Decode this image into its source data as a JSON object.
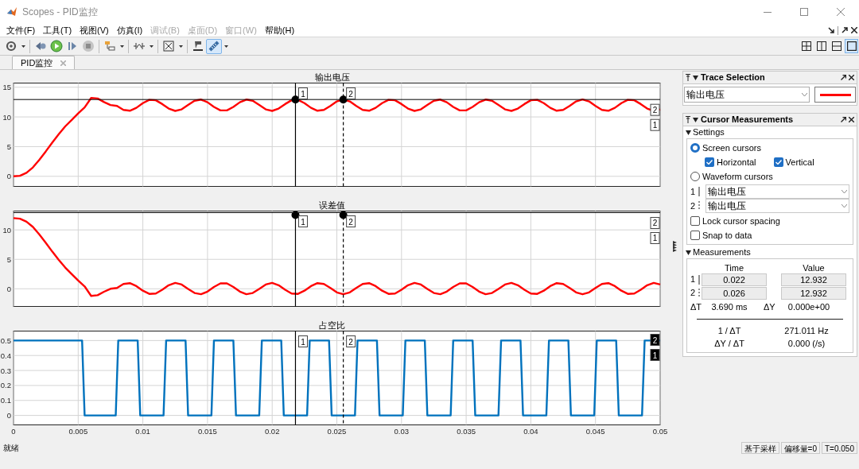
{
  "window": {
    "title": "Scopes - PID监控"
  },
  "menu": [
    {
      "label": "文件(F)",
      "disabled": false
    },
    {
      "label": "工具(T)",
      "disabled": false
    },
    {
      "label": "视图(V)",
      "disabled": false
    },
    {
      "label": "仿真(I)",
      "disabled": false
    },
    {
      "label": "调试(B)",
      "disabled": true
    },
    {
      "label": "桌面(D)",
      "disabled": true
    },
    {
      "label": "窗口(W)",
      "disabled": true
    },
    {
      "label": "帮助(H)",
      "disabled": false
    }
  ],
  "toolbar": [
    {
      "kind": "settings",
      "selected": false
    },
    {
      "kind": "step_back",
      "selected": false
    },
    {
      "kind": "run",
      "selected": false
    },
    {
      "kind": "step_forward",
      "selected": false
    },
    {
      "kind": "stop",
      "selected": false
    },
    {
      "kind": "highlight",
      "selected": false
    },
    {
      "kind": "trigger",
      "selected": false
    },
    {
      "kind": "zoom",
      "selected": false
    },
    {
      "kind": "style",
      "selected": false
    },
    {
      "kind": "cursor",
      "selected": true
    }
  ],
  "layouts": [
    {
      "kind": "grid4",
      "selected": false
    },
    {
      "kind": "cols2",
      "selected": false
    },
    {
      "kind": "rows2",
      "selected": false
    },
    {
      "kind": "single",
      "selected": true
    }
  ],
  "tabs": [
    {
      "label": "PID监控",
      "selected": true
    }
  ],
  "plots": [
    {
      "cursor_labels": {
        "vertical": [
          "1",
          "2"
        ],
        "horizontal": [
          "2",
          "1"
        ]
      },
      "chart_data": {
        "type": "line",
        "title": "输出电压",
        "grid": true,
        "xlim": [
          0,
          0.05
        ],
        "ylim": [
          -1.7,
          15.7
        ],
        "yticks": [
          0,
          5,
          10,
          15
        ],
        "x": [
          0,
          0.0005,
          0.001,
          0.0015,
          0.002,
          0.0025,
          0.003,
          0.0035,
          0.004,
          0.0045,
          0.005,
          0.0055,
          0.006,
          0.0065,
          0.007,
          0.0075,
          0.008,
          0.0085,
          0.009,
          0.0095,
          0.01,
          0.0105,
          0.011,
          0.0115,
          0.012,
          0.0125,
          0.013,
          0.0135,
          0.014,
          0.0145,
          0.015,
          0.0155,
          0.016,
          0.0165,
          0.017,
          0.0175,
          0.018,
          0.0185,
          0.019,
          0.0195,
          0.02,
          0.0205,
          0.021,
          0.0215,
          0.022,
          0.0225,
          0.023,
          0.0235,
          0.024,
          0.0245,
          0.025,
          0.0255,
          0.026,
          0.0265,
          0.027,
          0.0275,
          0.028,
          0.0285,
          0.029,
          0.0295,
          0.03,
          0.0305,
          0.031,
          0.0315,
          0.032,
          0.0325,
          0.033,
          0.0335,
          0.034,
          0.0345,
          0.035,
          0.0355,
          0.036,
          0.0365,
          0.037,
          0.0375,
          0.038,
          0.0385,
          0.039,
          0.0395,
          0.04,
          0.0405,
          0.041,
          0.0415,
          0.042,
          0.0425,
          0.043,
          0.0435,
          0.044,
          0.0445,
          0.045,
          0.0455,
          0.046,
          0.0465,
          0.047,
          0.0475,
          0.048,
          0.0485,
          0.049,
          0.0495,
          0.05
        ],
        "series": [
          {
            "color": "#ff0000",
            "values": [
              0,
              0.1,
              0.6,
              1.5,
              2.8,
              4.2,
              5.7,
              7.1,
              8.4,
              9.5,
              10.6,
              11.6,
              13.2,
              13.1,
              12.5,
              12.0,
              11.85,
              11.18,
              11.04,
              11.54,
              12.33,
              12.87,
              12.81,
              12.17,
              11.4,
              11.01,
              11.27,
              12.01,
              12.72,
              12.92,
              12.47,
              11.69,
              11.09,
              11.09,
              11.69,
              12.47,
              12.92,
              12.72,
              12.01,
              11.27,
              11.01,
              11.4,
              12.17,
              12.81,
              12.87,
              12.33,
              11.54,
              11.04,
              11.18,
              11.85,
              12.61,
              12.93,
              12.61,
              11.85,
              11.18,
              11.04,
              11.54,
              12.33,
              12.87,
              12.81,
              12.17,
              11.4,
              11.01,
              11.27,
              12.01,
              12.72,
              12.92,
              12.47,
              11.69,
              11.09,
              11.09,
              11.69,
              12.47,
              12.92,
              12.72,
              12.01,
              11.27,
              11.01,
              11.4,
              12.17,
              12.81,
              12.87,
              12.33,
              11.54,
              11.04,
              11.18,
              11.85,
              12.61,
              12.93,
              12.61,
              11.85,
              11.18,
              11.04,
              11.54,
              12.33,
              12.87,
              12.81,
              12.17,
              11.4,
              11.01,
              11.27
            ]
          }
        ],
        "ref_lines": [
          {
            "axis": "x",
            "value": 0.0218
          },
          {
            "axis": "x",
            "value": 0.0255
          },
          {
            "axis": "y",
            "value": 12.932
          }
        ]
      }
    },
    {
      "cursor_labels": {
        "vertical": [
          "1",
          "2"
        ],
        "horizontal": [
          "2",
          "1"
        ]
      },
      "chart_data": {
        "type": "line",
        "title": "误差值",
        "grid": true,
        "xlim": [
          0,
          0.05
        ],
        "ylim": [
          -3,
          13.2
        ],
        "yticks": [
          0,
          5,
          10
        ],
        "x": [
          0,
          0.0005,
          0.001,
          0.0015,
          0.002,
          0.0025,
          0.003,
          0.0035,
          0.004,
          0.0045,
          0.005,
          0.0055,
          0.006,
          0.0065,
          0.007,
          0.0075,
          0.008,
          0.0085,
          0.009,
          0.0095,
          0.01,
          0.0105,
          0.011,
          0.0115,
          0.012,
          0.0125,
          0.013,
          0.0135,
          0.014,
          0.0145,
          0.015,
          0.0155,
          0.016,
          0.0165,
          0.017,
          0.0175,
          0.018,
          0.0185,
          0.019,
          0.0195,
          0.02,
          0.0205,
          0.021,
          0.0215,
          0.022,
          0.0225,
          0.023,
          0.0235,
          0.024,
          0.0245,
          0.025,
          0.0255,
          0.026,
          0.0265,
          0.027,
          0.0275,
          0.028,
          0.0285,
          0.029,
          0.0295,
          0.03,
          0.0305,
          0.031,
          0.0315,
          0.032,
          0.0325,
          0.033,
          0.0335,
          0.034,
          0.0345,
          0.035,
          0.0355,
          0.036,
          0.0365,
          0.037,
          0.0375,
          0.038,
          0.0385,
          0.039,
          0.0395,
          0.04,
          0.0405,
          0.041,
          0.0415,
          0.042,
          0.0425,
          0.043,
          0.0435,
          0.044,
          0.0445,
          0.045,
          0.0455,
          0.046,
          0.0465,
          0.047,
          0.0475,
          0.048,
          0.0485,
          0.049,
          0.0495,
          0.05
        ],
        "series": [
          {
            "color": "#ff0000",
            "values": [
              12,
              11.9,
              11.4,
              10.5,
              9.2,
              7.8,
              6.3,
              4.9,
              3.6,
              2.5,
              1.4,
              0.4,
              -1.2,
              -1.1,
              -0.5,
              0.0,
              0.15,
              0.82,
              0.96,
              0.46,
              -0.33,
              -0.87,
              -0.81,
              -0.17,
              0.6,
              0.99,
              0.73,
              -0.01,
              -0.72,
              -0.92,
              -0.47,
              0.31,
              0.91,
              0.91,
              0.31,
              -0.47,
              -0.92,
              -0.72,
              -0.01,
              0.73,
              0.99,
              0.6,
              -0.17,
              -0.81,
              -0.87,
              -0.33,
              0.46,
              0.96,
              0.82,
              0.15,
              -0.61,
              -0.93,
              -0.61,
              0.15,
              0.82,
              0.96,
              0.46,
              -0.33,
              -0.87,
              -0.81,
              -0.17,
              0.6,
              0.99,
              0.73,
              -0.01,
              -0.72,
              -0.92,
              -0.47,
              0.31,
              0.91,
              0.91,
              0.31,
              -0.47,
              -0.92,
              -0.72,
              -0.01,
              0.73,
              0.99,
              0.6,
              -0.17,
              -0.81,
              -0.87,
              -0.33,
              0.46,
              0.96,
              0.82,
              0.15,
              -0.61,
              -0.93,
              -0.61,
              0.15,
              0.82,
              0.96,
              0.46,
              -0.33,
              -0.87,
              -0.81,
              -0.17,
              0.6,
              0.99,
              0.73
            ]
          }
        ],
        "ref_lines": [
          {
            "axis": "x",
            "value": 0.0218
          },
          {
            "axis": "x",
            "value": 0.0255
          },
          {
            "axis": "y",
            "value": 12.932
          }
        ]
      }
    },
    {
      "cursor_labels": {
        "vertical": [
          "1",
          "2"
        ],
        "horizontal": [
          "2",
          "1"
        ]
      },
      "chart_data": {
        "type": "line",
        "title": "占空比",
        "grid": true,
        "xlim": [
          0,
          0.05
        ],
        "ylim": [
          -0.063,
          0.563
        ],
        "xticks": [
          0,
          0.005,
          0.01,
          0.015,
          0.02,
          0.025,
          0.03,
          0.035,
          0.04,
          0.045,
          0.05
        ],
        "yticks": [
          0,
          0.1,
          0.2,
          0.3,
          0.4,
          0.5
        ],
        "x": [
          0,
          0.0053,
          0.0055,
          0.0079,
          0.0081,
          0.0096,
          0.0098,
          0.0116,
          0.0118,
          0.0133,
          0.0135,
          0.0153,
          0.0155,
          0.017,
          0.0172,
          0.019,
          0.0192,
          0.0207,
          0.0209,
          0.0227,
          0.0229,
          0.0244,
          0.0246,
          0.0264,
          0.0266,
          0.0281,
          0.0283,
          0.0301,
          0.0303,
          0.0318,
          0.032,
          0.0338,
          0.034,
          0.0355,
          0.0357,
          0.0375,
          0.0377,
          0.0392,
          0.0394,
          0.0412,
          0.0414,
          0.0429,
          0.0431,
          0.0449,
          0.0451,
          0.0466,
          0.0468,
          0.0486,
          0.0488,
          0.05
        ],
        "series": [
          {
            "color": "#0072bd",
            "values": [
              0.5,
              0.5,
              0,
              0,
              0.5,
              0.5,
              0,
              0,
              0.5,
              0.5,
              0,
              0,
              0.5,
              0.5,
              0,
              0,
              0.5,
              0.5,
              0,
              0,
              0.5,
              0.5,
              0,
              0,
              0.5,
              0.5,
              0,
              0,
              0.5,
              0.5,
              0,
              0,
              0.5,
              0.5,
              0,
              0,
              0.5,
              0.5,
              0,
              0,
              0.5,
              0.5,
              0,
              0,
              0.5,
              0.5,
              0,
              0,
              0.5,
              0.5
            ]
          }
        ],
        "ref_lines": [
          {
            "axis": "x",
            "value": 0.0218
          },
          {
            "axis": "x",
            "value": 0.0255
          }
        ]
      }
    }
  ],
  "trace_selection": {
    "title": "Trace Selection",
    "signal": "输出电压",
    "color": "#ff0000"
  },
  "cursor_measurements": {
    "title": "Cursor Measurements",
    "settings": {
      "title": "Settings",
      "expanded": true,
      "screen_cursors": {
        "label": "Screen cursors",
        "selected": true
      },
      "directions": [
        {
          "label": "Horizontal",
          "checked": true
        },
        {
          "label": "Vertical",
          "checked": true
        }
      ],
      "waveform_cursors": {
        "label": "Waveform cursors",
        "selected": false
      },
      "cursor_signals": [
        {
          "label": "1",
          "signal": "输出电压"
        },
        {
          "label": "2",
          "signal": "输出电压"
        }
      ],
      "options": [
        {
          "label": "Lock cursor spacing",
          "checked": false
        },
        {
          "label": "Snap to data",
          "checked": false
        }
      ]
    },
    "measurements": {
      "title": "Measurements",
      "expanded": true,
      "columns": [
        "Time",
        "Value"
      ],
      "rows": [
        {
          "label": "1",
          "time": "0.022",
          "value": "12.932"
        },
        {
          "label": "2",
          "time": "0.026",
          "value": "12.932"
        }
      ],
      "delta_t": {
        "label": "ΔT",
        "value": "3.690 ms"
      },
      "delta_y": {
        "label": "ΔY",
        "value": "0.000e+00"
      },
      "derived": [
        {
          "label": "1 / ΔT",
          "value": "271.011 Hz"
        },
        {
          "label": "ΔY / ΔT",
          "value": "0.000 (/s)"
        }
      ]
    }
  },
  "status_bar": {
    "text": "就绪",
    "fields": [
      "基于采样",
      "偏移量=0",
      "T=0.050"
    ]
  }
}
